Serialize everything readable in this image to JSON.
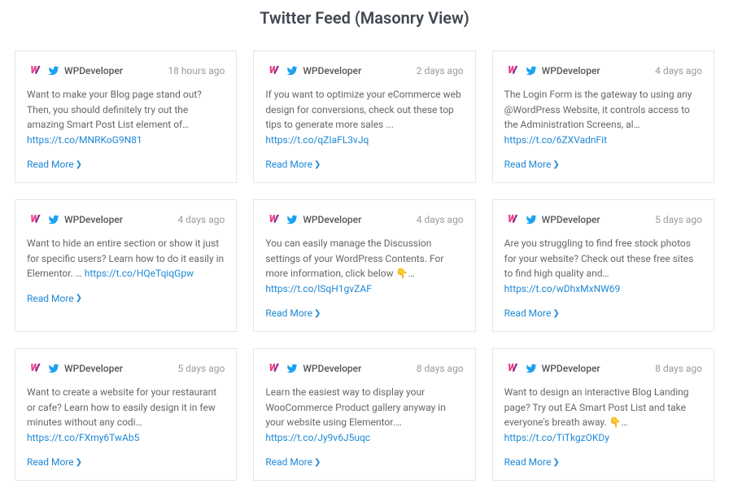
{
  "title": "Twitter Feed (Masonry View)",
  "handle": "WPDeveloper",
  "read_more": "Read More",
  "cards": [
    {
      "time": "18 hours ago",
      "text": "Want to make your Blog page stand out? Then, you should definitely try out the amazing  Smart Post List element of… ",
      "link": "https://t.co/MNRKoG9N81",
      "has_pointer": false
    },
    {
      "time": "2 days ago",
      "text": "If you want to optimize your eCommerce web design for conversions, check out these top tips to generate more sales ... ",
      "link": "https://t.co/qZIaFL3vJq",
      "has_pointer": false
    },
    {
      "time": "4 days ago",
      "text": "The Login Form is the gateway to using any @WordPress Website, it controls access to the Administration Screens, al… ",
      "link": "https://t.co/6ZXVadnFit",
      "has_pointer": false
    },
    {
      "time": "4 days ago",
      "text": "Want to hide an entire section or show it just for specific users? Learn how to do it easily in Elementor. … ",
      "link": "https://t.co/HQeTqiqGpw",
      "has_pointer": false
    },
    {
      "time": "4 days ago",
      "text": "You can easily manage the Discussion settings of your WordPress Contents. For more information, click below ",
      "link": "https://t.co/lSqH1gvZAF",
      "has_pointer": true
    },
    {
      "time": "5 days ago",
      "text": "Are you struggling to find free stock photos for your website? Check out these free sites to find high quality and… ",
      "link": "https://t.co/wDhxMxNW69",
      "has_pointer": false
    },
    {
      "time": "5 days ago",
      "text": "Want to create a website for your restaurant or cafe? Learn how to easily design it in few minutes without any codi… ",
      "link": "https://t.co/FXmy6TwAb5",
      "has_pointer": false
    },
    {
      "time": "8 days ago",
      "text": "Learn the easiest way to display your WooCommerce Product gallery anyway in your website using Elementor.… ",
      "link": "https://t.co/Jy9v6J5uqc",
      "has_pointer": false
    },
    {
      "time": "8 days ago",
      "text": "Want to design an interactive Blog Landing page? Try out EA Smart Post List and take everyone's breath away. ",
      "link": "https://t.co/TiTkgzOKDy",
      "has_pointer": true
    }
  ]
}
